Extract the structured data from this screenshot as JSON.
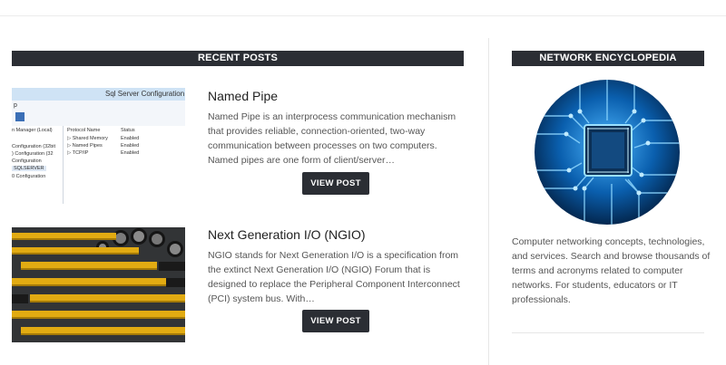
{
  "recent_posts": {
    "heading": "RECENT POSTS",
    "posts": [
      {
        "title": "Named Pipe",
        "excerpt": "Named Pipe is an interprocess communication mechanism that provides reliable, connection-oriented, two-way communication between processes on two computers. Named pipes are one form of client/server…",
        "button": "VIEW POST",
        "thumb": {
          "window_title": "Sql Server Configuration M",
          "menu_letter": "p",
          "left_items": [
            "n Manager (Local)",
            "Configuration (32bit",
            ") Configuration (32",
            "Configuration",
            "SQLSERVER",
            "0 Configuration"
          ],
          "col_protocol": "Protocol Name",
          "col_status": "Status",
          "rows": [
            {
              "name": "Shared Memory",
              "status": "Enabled"
            },
            {
              "name": "Named Pipes",
              "status": "Enabled"
            },
            {
              "name": "TCP/IP",
              "status": "Enabled"
            }
          ]
        }
      },
      {
        "title": "Next Generation I/O (NGIO)",
        "excerpt": "NGIO stands for Next Generation I/O is a specification from the extinct Next Generation I/O (NGIO) Forum that is designed to replace the Peripheral Component Interconnect (PCI) system bus. With…",
        "button": "VIEW POST"
      }
    ]
  },
  "encyclopedia": {
    "heading": "NETWORK ENCYCLOPEDIA",
    "description": "Computer networking concepts, technologies, and services. Search and browse thousands of terms and acronyms related to computer networks. For students, educators or IT professionals."
  },
  "colors": {
    "heading_bg": "#2b2e34",
    "text": "#555555",
    "title": "#1f1f1f",
    "circuit_blue": "#1a8fe0"
  }
}
